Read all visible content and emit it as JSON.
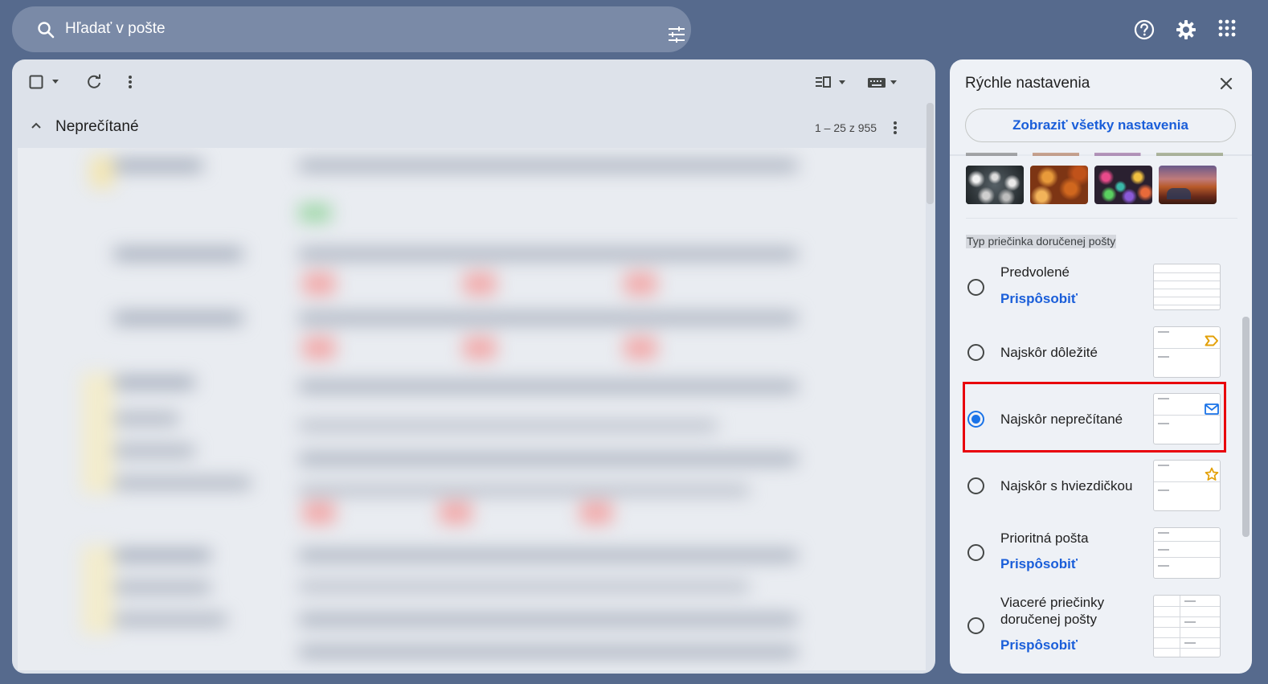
{
  "search": {
    "placeholder": "Hľadať v pošte",
    "search_icon": "search-icon",
    "options_icon": "tune-icon"
  },
  "header_icons": [
    "help-icon",
    "gear-icon",
    "apps-grid-icon"
  ],
  "mail": {
    "section_title": "Neprečítané",
    "pager": "1 – 25 z 955",
    "toolbar_icons": [
      "checkbox-icon",
      "refresh-icon",
      "more-vert-icon",
      "split-pane-icon",
      "keyboard-icon"
    ]
  },
  "quick_settings": {
    "title": "Rýchle nastavenia",
    "all_settings_button": "Zobraziť všetky nastavenia",
    "themes": [
      "bubbles-theme",
      "leaves-theme",
      "marbles-theme",
      "canyon-theme"
    ],
    "inbox_type_label": "Typ priečinka doručenej pošty",
    "options": [
      {
        "label": "Predvolené",
        "link": "Prispôsobiť",
        "checked": false,
        "preview_icon": ""
      },
      {
        "label": "Najskôr dôležité",
        "link": "",
        "checked": false,
        "preview_icon": "important-marker-icon"
      },
      {
        "label": "Najskôr neprečítané",
        "link": "",
        "checked": true,
        "preview_icon": "envelope-icon"
      },
      {
        "label": "Najskôr s hviezdičkou",
        "link": "",
        "checked": false,
        "preview_icon": "star-icon"
      },
      {
        "label": "Prioritná pošta",
        "link": "Prispôsobiť",
        "checked": false,
        "preview_icon": ""
      },
      {
        "label_line1": "Viaceré priečinky",
        "label_line2": "doručenej pošty",
        "link": "Prispôsobiť",
        "checked": false,
        "preview_icon": ""
      }
    ]
  },
  "colors": {
    "page_bg": "#566a8d",
    "link": "#1a5ed9",
    "radio_checked": "#1a73e8",
    "highlight": "#e8000b",
    "important": "#e3a008",
    "star": "#e3a008"
  }
}
